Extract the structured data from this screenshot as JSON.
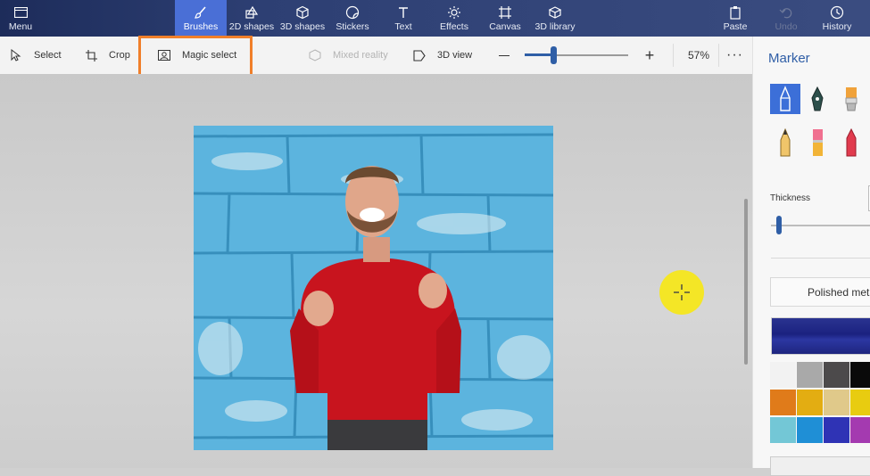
{
  "topbar": {
    "menu": "Menu",
    "tools": [
      {
        "label": "Brushes",
        "icon": "brush-icon",
        "active": true
      },
      {
        "label": "2D shapes",
        "icon": "2d-shapes-icon"
      },
      {
        "label": "3D shapes",
        "icon": "3d-shapes-icon"
      },
      {
        "label": "Stickers",
        "icon": "stickers-icon"
      },
      {
        "label": "Text",
        "icon": "text-icon"
      },
      {
        "label": "Effects",
        "icon": "effects-icon"
      },
      {
        "label": "Canvas",
        "icon": "canvas-icon"
      },
      {
        "label": "3D library",
        "icon": "3d-library-icon"
      }
    ],
    "paste": "Paste",
    "undo": "Undo",
    "history": "History"
  },
  "subbar": {
    "select": "Select",
    "crop": "Crop",
    "magic_select": "Magic select",
    "mixed_reality": "Mixed reality",
    "view_3d": "3D view",
    "zoom": "57%",
    "zoom_level": 0.57
  },
  "panel": {
    "title": "Marker",
    "brushes": [
      "marker-icon",
      "calligraphy-pen-icon",
      "oil-brush-icon",
      "pencil-icon",
      "eraser-icon",
      "crayon-icon"
    ],
    "thickness_label": "Thickness",
    "finish": "Polished metal",
    "selected_color": "#1f2585",
    "swatches": [
      "#f2f2f2",
      "#a9a9a9",
      "#4c4a4b",
      "#0a0a0a",
      "#e07b1a",
      "#e3ad12",
      "#e0c98a",
      "#e8cc10",
      "#73c7d6",
      "#1f8fd6",
      "#2f33b5",
      "#a43ab0"
    ]
  },
  "colors": {
    "accent": "#4a6fd6",
    "highlight": "#f07f2a",
    "cursor": "#f4e626"
  }
}
